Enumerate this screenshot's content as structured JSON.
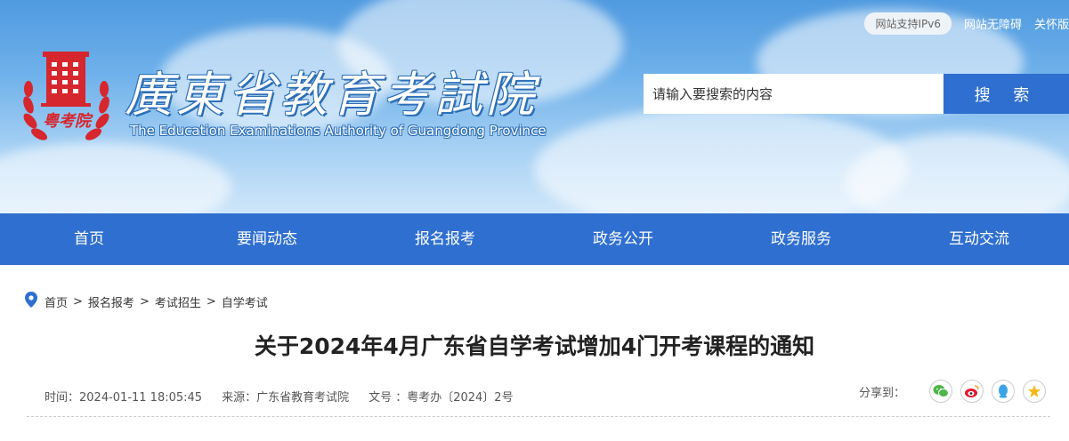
{
  "header": {
    "ipv6_badge": "网站支持IPv6",
    "accessibility_link": "网站无障碍",
    "care_link": "关怀版",
    "site_title": "廣東省教育考試院",
    "site_subtitle": "The Education Examinations Authority of Guangdong Province",
    "logo_text": "粤考院"
  },
  "search": {
    "placeholder": "请输入要搜索的内容",
    "button_label": "搜 索"
  },
  "nav": {
    "items": [
      "首页",
      "要闻动态",
      "报名报考",
      "政务公开",
      "政务服务",
      "互动交流"
    ]
  },
  "breadcrumb": {
    "items": [
      "首页",
      "报名报考",
      "考试招生",
      "自学考试"
    ],
    "separator": ">"
  },
  "article": {
    "title": "关于2024年4月广东省自学考试增加4门开考课程的通知",
    "time": "时间：2024-01-11 18:05:45",
    "source": "来源：广东省教育考试院",
    "doc_no": "文号 ：粤考办〔2024〕2号"
  },
  "share": {
    "label": "分享到：",
    "icons": [
      "wechat-icon",
      "weibo-icon",
      "qq-icon",
      "qzone-icon"
    ]
  },
  "colors": {
    "nav_blue": "#2f6fd0",
    "logo_red": "#d6262e"
  }
}
